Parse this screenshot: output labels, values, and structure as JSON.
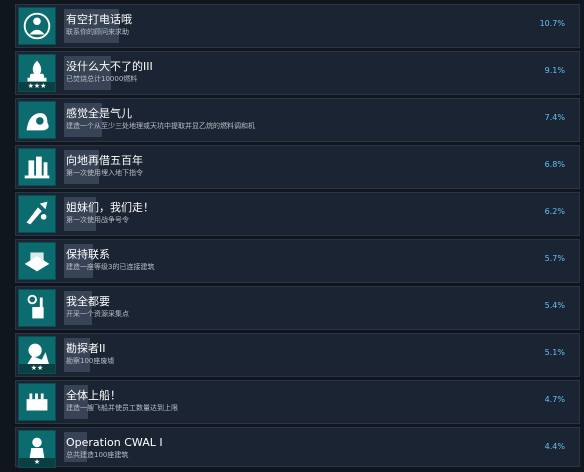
{
  "achievements": [
    {
      "name": "有空打电话哦",
      "desc": "联系你的顾问来求助",
      "percent": "10.7%",
      "progress": 0.107,
      "icon": "phone-call-icon",
      "stars": 0
    },
    {
      "name": "没什么大不了的III",
      "desc": "已焚烧总计10000燃料",
      "percent": "9.1%",
      "progress": 0.091,
      "icon": "fire-burner-icon",
      "stars": 3
    },
    {
      "name": "感觉全是气儿",
      "desc": "建造一个从至少三处地理或天坑中提取并显乙烷的燃料调和机",
      "percent": "7.4%",
      "progress": 0.074,
      "icon": "gas-refinery-icon",
      "stars": 0
    },
    {
      "name": "向地再借五百年",
      "desc": "第一次使用埋入地下指令",
      "percent": "6.8%",
      "progress": 0.068,
      "icon": "bury-underground-icon",
      "stars": 0
    },
    {
      "name": "姐妹们，我们走！",
      "desc": "第一次使用战争号令",
      "percent": "6.2%",
      "progress": 0.062,
      "icon": "war-horn-icon",
      "stars": 0
    },
    {
      "name": "保持联系",
      "desc": "建造一座等级3的已连接建筑",
      "percent": "5.7%",
      "progress": 0.057,
      "icon": "connected-buildings-icon",
      "stars": 0
    },
    {
      "name": "我全都要",
      "desc": "开采一个资源采集点",
      "percent": "5.4%",
      "progress": 0.054,
      "icon": "resource-drill-icon",
      "stars": 0
    },
    {
      "name": "勘探者II",
      "desc": "勘察100座废墟",
      "percent": "5.1%",
      "progress": 0.051,
      "icon": "prospector-icon",
      "stars": 2
    },
    {
      "name": "全体上船！",
      "desc": "建造一艘飞船并使员工数量达到上限",
      "percent": "4.7%",
      "progress": 0.047,
      "icon": "airship-crew-icon",
      "stars": 0
    },
    {
      "name": "Operation CWAL I",
      "desc": "总共建造100座建筑",
      "percent": "4.4%",
      "progress": 0.044,
      "icon": "construction-worker-icon",
      "stars": 1
    }
  ],
  "colors": {
    "icon_bg": "#0c6b6e",
    "row_bg": "#1a2432",
    "percent": "#66c0f4"
  }
}
